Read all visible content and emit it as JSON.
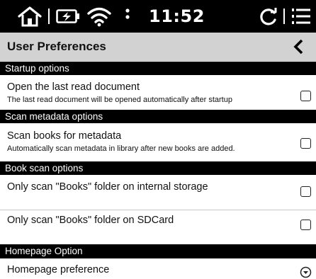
{
  "status_bar": {
    "time": "11:52",
    "icons": [
      "home-icon",
      "battery-charging-icon",
      "wifi-icon",
      "more-vertical-icon",
      "refresh-icon",
      "menu-list-icon"
    ]
  },
  "header": {
    "title": "User Preferences",
    "back_icon": "chevron-left-icon"
  },
  "sections": [
    {
      "label": "Startup options",
      "items": [
        {
          "title": "Open the last read document",
          "subtitle": "The last read document will be opened automatically after startup",
          "control": "checkbox",
          "checked": false
        }
      ]
    },
    {
      "label": "Scan metadata options",
      "items": [
        {
          "title": "Scan books for metadata",
          "subtitle": "Automatically scan metadata in library after new books are added.",
          "control": "checkbox",
          "checked": false
        }
      ]
    },
    {
      "label": "Book scan options",
      "items": [
        {
          "title": "Only scan \"Books\" folder on internal storage",
          "control": "checkbox",
          "checked": false
        },
        {
          "title": "Only scan \"Books\" folder on SDCard",
          "control": "checkbox",
          "checked": false
        }
      ]
    },
    {
      "label": "Homepage Option",
      "items": [
        {
          "title": "Homepage preference",
          "control": "dropdown"
        }
      ]
    }
  ],
  "colors": {
    "status_bar_bg": "#000000",
    "title_bar_bg": "#d2d2d2",
    "section_header_bg": "#000000",
    "background": "#ffffff"
  }
}
